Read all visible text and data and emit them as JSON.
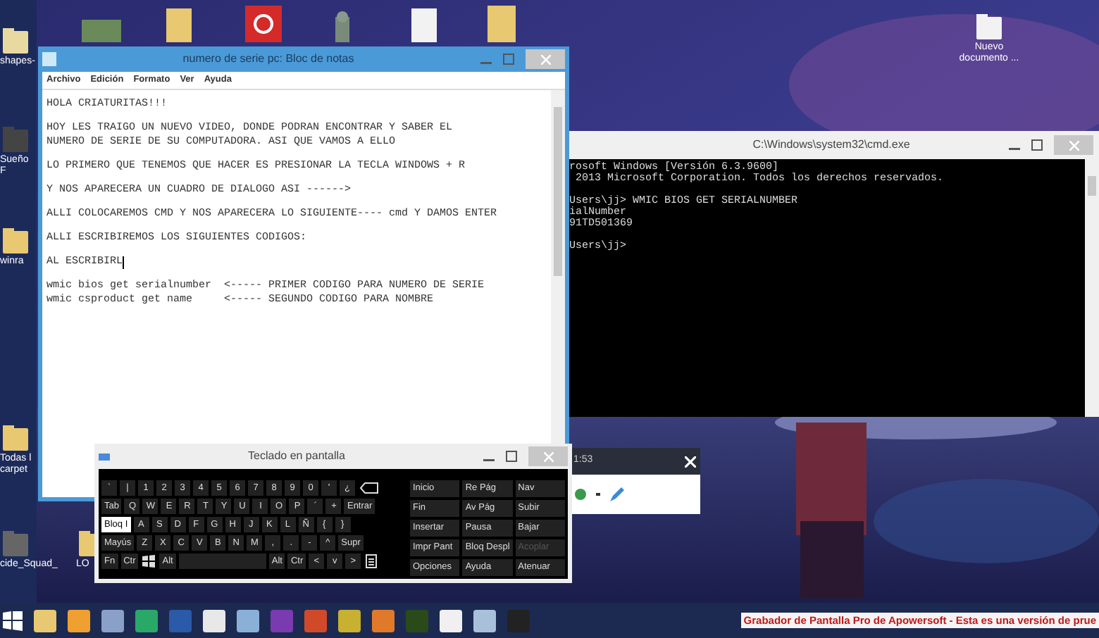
{
  "desktop_icons": [
    {
      "label": "shapes-"
    },
    {
      "label": "Sueño F"
    },
    {
      "label": "winra"
    },
    {
      "label": "Todas l carpet"
    },
    {
      "label": "cide_Squad_"
    },
    {
      "label": "LO"
    },
    {
      "label": "Nuevo documento ..."
    }
  ],
  "notepad": {
    "title": "numero de serie pc: Bloc de notas",
    "menu": [
      "Archivo",
      "Edición",
      "Formato",
      "Ver",
      "Ayuda"
    ],
    "paragraphs": [
      {
        "lines": [
          "HOLA CRIATURITAS!!!"
        ],
        "cursor": false
      },
      {
        "lines": [
          "HOY LES TRAIGO UN NUEVO VIDEO, DONDE PODRAN ENCONTRAR Y SABER EL",
          "NUMERO DE SERIE DE SU COMPUTADORA. ASI QUE VAMOS A ELLO"
        ],
        "cursor": false
      },
      {
        "lines": [
          "LO PRIMERO QUE TENEMOS QUE HACER ES PRESIONAR LA TECLA WINDOWS + R"
        ],
        "cursor": false
      },
      {
        "lines": [
          "Y NOS APARECERA UN CUADRO DE DIALOGO ASI ------>"
        ],
        "cursor": false
      },
      {
        "lines": [
          "ALLI COLOCAREMOS CMD Y NOS APARECERA LO SIGUIENTE---- cmd Y DAMOS ENTER"
        ],
        "cursor": false
      },
      {
        "lines": [
          "ALLI ESCRIBIREMOS LOS SIGUIENTES CODIGOS:"
        ],
        "cursor": false
      },
      {
        "lines": [
          "AL ESCRIBIRL"
        ],
        "cursor": true
      },
      {
        "lines": [
          "wmic bios get serialnumber  <----- PRIMER CODIGO PARA NUMERO DE SERIE",
          "wmic csproduct get name     <----- SEGUNDO CODIGO PARA NOMBRE"
        ],
        "cursor": false
      }
    ]
  },
  "cmd": {
    "title": "C:\\Windows\\system32\\cmd.exe",
    "blocks": [
      [
        "rosoft Windows [Versión 6.3.9600]",
        " 2013 Microsoft Corporation. Todos los derechos reservados."
      ],
      [
        "Users\\jj> WMIC BIOS GET SERIALNUMBER",
        "ialNumber",
        "91TD501369"
      ],
      [
        "Users\\jj>"
      ]
    ]
  },
  "recorder": {
    "time": "1:53"
  },
  "keyboard": {
    "title": "Teclado en pantalla",
    "caps_lock": true,
    "rows": [
      [
        "`",
        "|",
        "1",
        "2",
        "3",
        "4",
        "5",
        "6",
        "7",
        "8",
        "9",
        "0",
        "'",
        "¿",
        {
          "kind": "backspace"
        }
      ],
      [
        "Tab",
        "Q",
        "W",
        "E",
        "R",
        "T",
        "Y",
        "U",
        "I",
        "O",
        "P",
        "´",
        "+",
        "Entrar"
      ],
      [
        "Bloq I",
        "A",
        "S",
        "D",
        "F",
        "G",
        "H",
        "J",
        "K",
        "L",
        "Ñ",
        "{",
        "}"
      ],
      [
        "Mayús",
        "Z",
        "X",
        "C",
        "V",
        "B",
        "N",
        "M",
        ",",
        ".",
        "-",
        "^",
        "Supr"
      ],
      [
        "Fn",
        "Ctr",
        {
          "kind": "windows"
        },
        "Alt",
        {
          "kind": "space"
        },
        "Alt",
        "Ctr",
        "<",
        "v",
        ">",
        {
          "kind": "menu"
        }
      ]
    ],
    "nav_keys": [
      {
        "label": "Inicio",
        "disabled": false
      },
      {
        "label": "Re Pág",
        "disabled": false
      },
      {
        "label": "Nav",
        "disabled": false
      },
      {
        "label": "Fin",
        "disabled": false
      },
      {
        "label": "Av Pág",
        "disabled": false
      },
      {
        "label": "Subir",
        "disabled": false
      },
      {
        "label": "Insertar",
        "disabled": false
      },
      {
        "label": "Pausa",
        "disabled": false
      },
      {
        "label": "Bajar",
        "disabled": false
      },
      {
        "label": "Impr Pant",
        "disabled": false
      },
      {
        "label": "Bloq Despl",
        "disabled": false
      },
      {
        "label": "Acoplar",
        "disabled": true
      },
      {
        "label": "Opciones",
        "disabled": false
      },
      {
        "label": "Ayuda",
        "disabled": false
      },
      {
        "label": "Atenuar",
        "disabled": false
      }
    ]
  },
  "taskbar": {
    "banner": "Grabador de Pantalla Pro de Apowersoft - Esta es una versión de prue"
  }
}
